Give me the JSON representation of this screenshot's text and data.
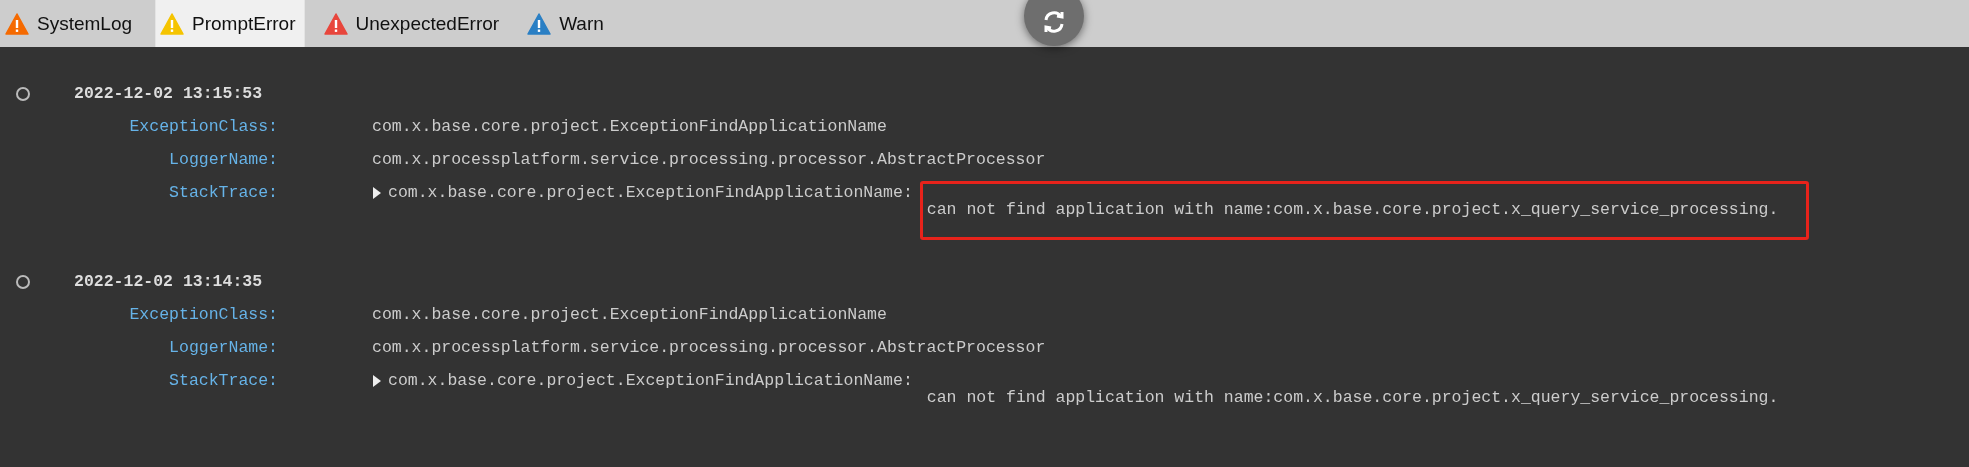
{
  "tabs": [
    {
      "label": "SystemLog",
      "selected": false,
      "color": "#f56a00"
    },
    {
      "label": "PromptError",
      "selected": true,
      "color": "#f5c400"
    },
    {
      "label": "UnexpectedError",
      "selected": false,
      "color": "#e8463c"
    },
    {
      "label": "Warn",
      "selected": false,
      "color": "#2a7fc4"
    }
  ],
  "entries": [
    {
      "timestamp": "2022-12-02 13:15:53",
      "fields": [
        {
          "kind": "text",
          "label": "ExceptionClass:",
          "value": "com.x.base.core.project.ExceptionFindApplicationName"
        },
        {
          "kind": "text",
          "label": "LoggerName:",
          "value": "com.x.processplatform.service.processing.processor.AbstractProcessor"
        },
        {
          "kind": "trace",
          "label": "StackTrace:",
          "expanded": false,
          "value": "com.x.base.core.project.ExceptionFindApplicationName:",
          "message": "can not find application with name:com.x.base.core.project.x_query_service_processing.",
          "highlighted": true
        }
      ]
    },
    {
      "timestamp": "2022-12-02 13:14:35",
      "fields": [
        {
          "kind": "text",
          "label": "ExceptionClass:",
          "value": "com.x.base.core.project.ExceptionFindApplicationName"
        },
        {
          "kind": "text",
          "label": "LoggerName:",
          "value": "com.x.processplatform.service.processing.processor.AbstractProcessor"
        },
        {
          "kind": "trace",
          "label": "StackTrace:",
          "expanded": false,
          "value": "com.x.base.core.project.ExceptionFindApplicationName:",
          "message": "can not find application with name:com.x.base.core.project.x_query_service_processing.",
          "highlighted": false
        }
      ]
    }
  ]
}
